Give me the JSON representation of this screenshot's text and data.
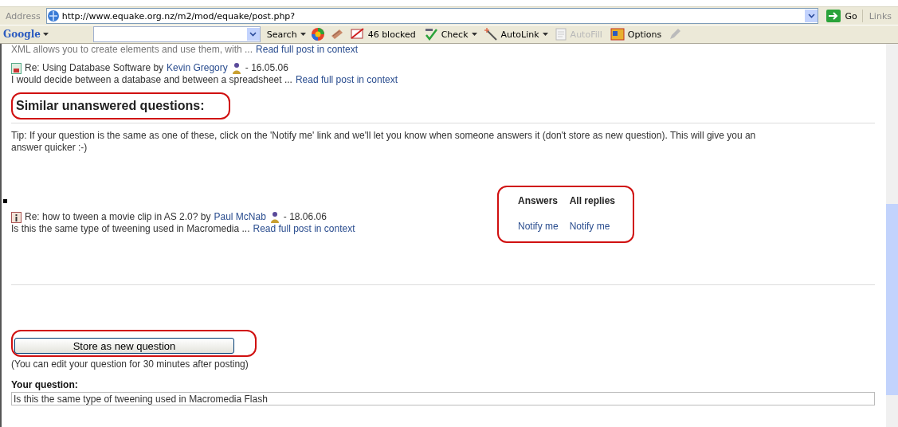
{
  "address_bar": {
    "label": "Address",
    "url": "http://www.equake.org.nz/m2/mod/equake/post.php?",
    "go": "Go",
    "links": "Links"
  },
  "google_toolbar": {
    "logo": "Google",
    "search": "Search",
    "blocked": "46 blocked",
    "check": "Check",
    "autolink": "AutoLink",
    "autofill": {
      "label": "AutoFill",
      "disabled": true
    },
    "options": "Options"
  },
  "previous_post": {
    "excerpt": "XML allows you to create elements and use them, with ...",
    "link": "Read full post in context"
  },
  "related_post": {
    "title": "Re: Using Database Software by",
    "author": "Kevin Gregory",
    "date": "- 16.05.06",
    "excerpt": "I would decide between a database and between a spreadsheet ...",
    "link": "Read full post in context"
  },
  "similar": {
    "heading": "Similar unanswered questions:",
    "heading_circled": true,
    "tip": "Tip: If your question is the same as one of these, click on the 'Notify me' link and we'll let you know when someone answers it (don't store as new question). This will give you an answer quicker :-)",
    "columns_circled": true,
    "columns": [
      "Answers",
      "All replies"
    ],
    "questions": [
      {
        "title": "Re: how to tween a movie clip in AS 2.0? by",
        "author": "Paul McNab",
        "date": "- 18.06.06",
        "excerpt": "Is this the same type of tweening used in Macromedia ...",
        "link": "Read full post in context",
        "notify": [
          "Notify me",
          "Notify me"
        ]
      }
    ]
  },
  "store": {
    "button": "Store as new question",
    "circled": true,
    "note": "(You can edit your question for 30 minutes after posting)"
  },
  "your_question": {
    "label": "Your question:",
    "value": "Is this the same type of tweening used in Macromedia Flash"
  }
}
